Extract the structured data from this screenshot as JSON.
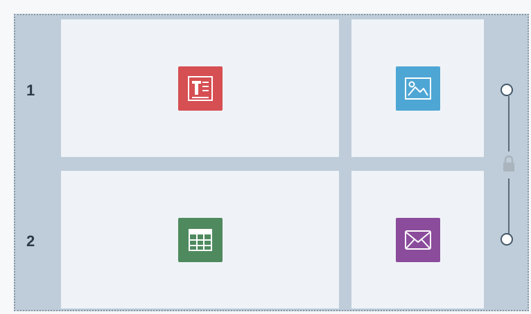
{
  "rows": [
    {
      "number": "1"
    },
    {
      "number": "2"
    }
  ],
  "cells": [
    {
      "row": 1,
      "col": 1,
      "icon": "text-block-icon",
      "color": "#d64f52"
    },
    {
      "row": 1,
      "col": 2,
      "icon": "image-block-icon",
      "color": "#4ea6d5"
    },
    {
      "row": 2,
      "col": 1,
      "icon": "table-block-icon",
      "color": "#4f8a5f"
    },
    {
      "row": 2,
      "col": 2,
      "icon": "email-block-icon",
      "color": "#8b4c9c"
    }
  ],
  "resize_control": {
    "top_handle": "circle-handle",
    "bottom_handle": "circle-handle",
    "lock_icon": "lock-icon"
  },
  "colors": {
    "background": "#becdd9",
    "cell": "#eff3f7",
    "row_number": "#2b3a46",
    "handle_border": "#43576a"
  }
}
